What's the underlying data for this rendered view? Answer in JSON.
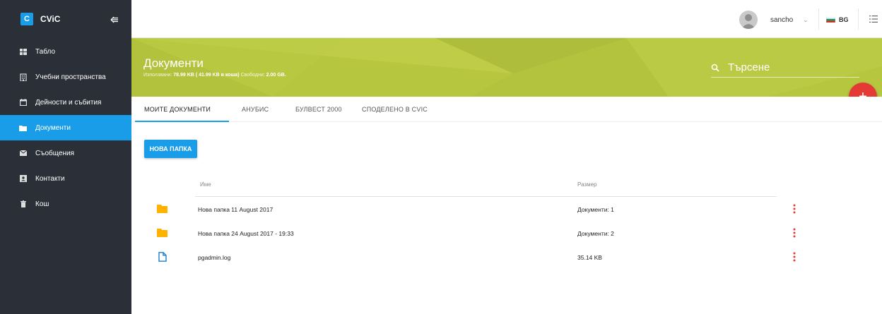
{
  "app": {
    "logo_letter": "C",
    "name": "CViC"
  },
  "sidebar": {
    "items": [
      {
        "label": "Табло",
        "icon": "dashboard-icon",
        "active": false
      },
      {
        "label": "Учебни пространства",
        "icon": "building-icon",
        "active": false
      },
      {
        "label": "Дейности и събития",
        "icon": "calendar-icon",
        "active": false
      },
      {
        "label": "Документи",
        "icon": "folder-icon",
        "active": true
      },
      {
        "label": "Съобщения",
        "icon": "mail-icon",
        "active": false
      },
      {
        "label": "Контакти",
        "icon": "contact-card-icon",
        "active": false
      },
      {
        "label": "Кош",
        "icon": "trash-icon",
        "active": false
      }
    ]
  },
  "topbar": {
    "username": "sancho",
    "language": "BG"
  },
  "header": {
    "title": "Документи",
    "storage_used_label": "Използвани:",
    "storage_used_value": "78.99 KB",
    "storage_trash_value": "( 41.99 KB в коша)",
    "storage_free_label": "Свободни:",
    "storage_free_value": "2.00 GB.",
    "search_placeholder": "Търсене"
  },
  "tabs": [
    {
      "label": "МОИТЕ ДОКУМЕНТИ",
      "active": true
    },
    {
      "label": "АНУБИС",
      "active": false
    },
    {
      "label": "БУЛВЕСТ 2000",
      "active": false
    },
    {
      "label": "СПОДЕЛЕНО В CVIC",
      "active": false
    }
  ],
  "toolbar": {
    "new_folder_label": "НОВА ПАПКА"
  },
  "table": {
    "columns": {
      "name": "Име",
      "size": "Размер"
    },
    "rows": [
      {
        "type": "folder",
        "name": "Нова папка 11 August 2017",
        "size": "Документи: 1"
      },
      {
        "type": "folder",
        "name": "Нова папка 24 August 2017 - 19:33",
        "size": "Документи: 2"
      },
      {
        "type": "file",
        "name": "pgadmin.log",
        "size": "35.14 KB"
      }
    ]
  },
  "colors": {
    "sidebar_bg": "#2b2f38",
    "accent_blue": "#1a9de8",
    "banner_green": "#b7c63f",
    "fab_red": "#e53935",
    "folder_yellow": "#ffb300"
  }
}
